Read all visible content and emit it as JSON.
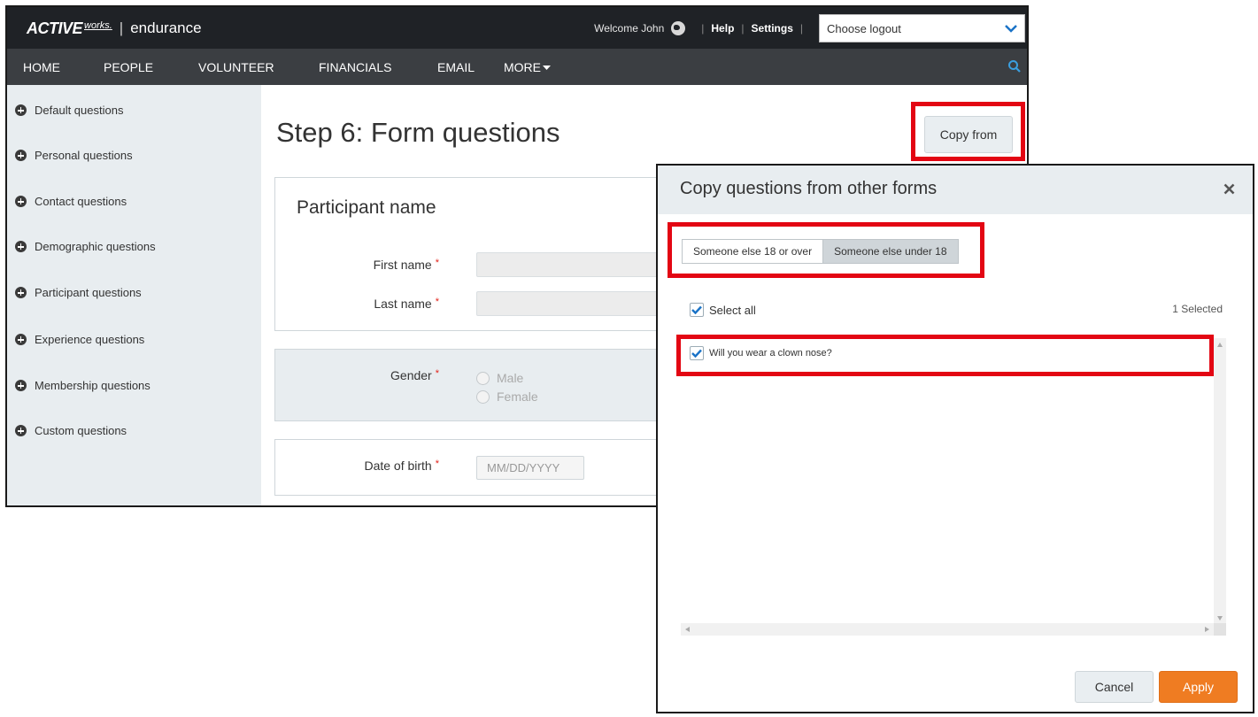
{
  "header": {
    "brand_active": "ACTIVE",
    "brand_works": "works.",
    "brand_sep": "|",
    "brand_product": "endurance",
    "welcome": "Welcome John",
    "help": "Help",
    "settings": "Settings",
    "separator": "|",
    "logout_placeholder": "Choose logout"
  },
  "nav": {
    "home": "HOME",
    "people": "PEOPLE",
    "volunteer": "VOLUNTEER",
    "financials": "FINANCIALS",
    "email": "EMAIL",
    "more": "MORE"
  },
  "sidebar": {
    "items": [
      "Default questions",
      "Personal questions",
      "Contact questions",
      "Demographic questions",
      "Participant questions",
      "Experience questions",
      "Membership questions",
      "Custom questions"
    ]
  },
  "main": {
    "title": "Step 6: Form questions",
    "copy_from": "Copy from",
    "participant_section": "Participant name",
    "first_name": "First name",
    "last_name": "Last name",
    "gender": "Gender",
    "gender_options": [
      "Male",
      "Female"
    ],
    "dob": "Date of birth",
    "dob_placeholder": "MM/DD/YYYY",
    "required_mark": "*"
  },
  "modal": {
    "title": "Copy questions from other forms",
    "toggle_over": "Someone else 18 or over",
    "toggle_under": "Someone else under 18",
    "select_all": "Select all",
    "selected_count": "1 Selected",
    "questions": [
      "Will you wear a clown nose?"
    ],
    "cancel": "Cancel",
    "apply": "Apply"
  },
  "colors": {
    "topbar": "#1f2226",
    "navbar": "#3b3e42",
    "sidebar": "#e8edf0",
    "apply": "#ef7c22",
    "highlight": "#e30613",
    "check": "#1a73c7"
  }
}
